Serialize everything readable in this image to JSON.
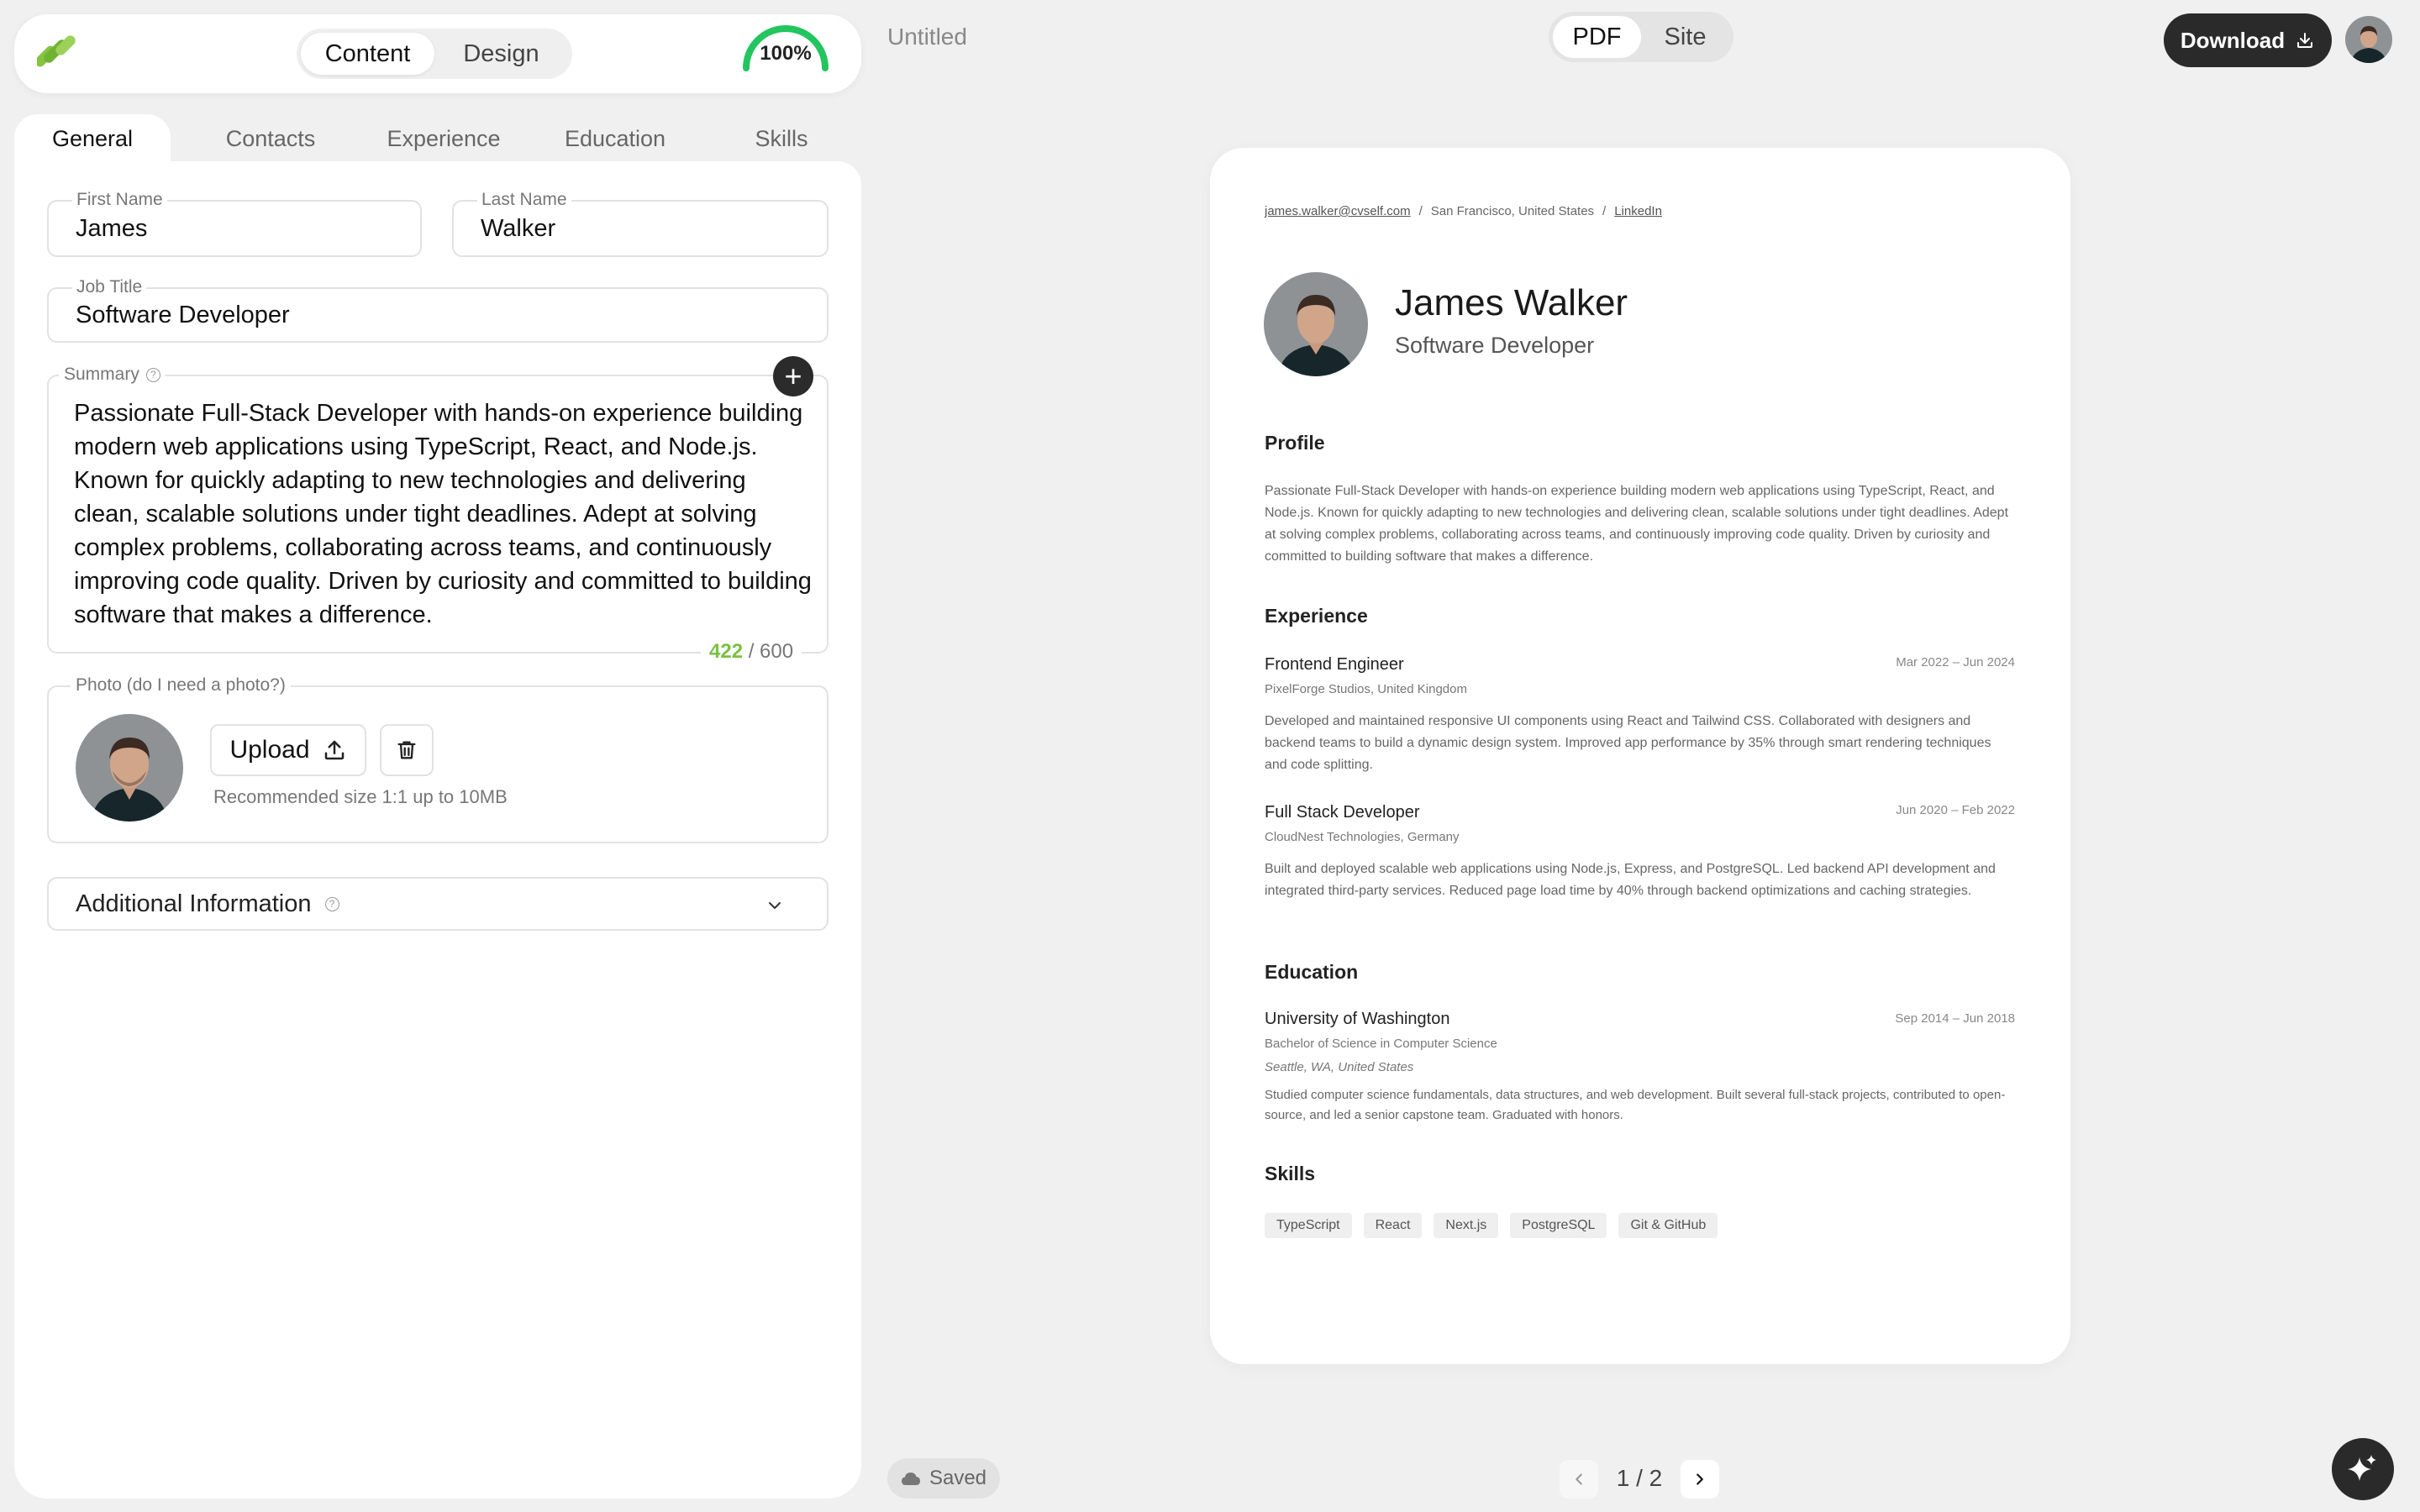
{
  "app": {
    "mode_tabs": [
      "Content",
      "Design"
    ],
    "completion": "100%",
    "completion_value": 1.0,
    "document_title": "Untitled",
    "view_tabs": [
      "PDF",
      "Site"
    ],
    "download_label": "Download",
    "saved_label": "Saved",
    "pager": "1 / 2"
  },
  "section_tabs": [
    "General",
    "Contacts",
    "Experience",
    "Education",
    "Skills"
  ],
  "form": {
    "first_name": {
      "label": "First Name",
      "value": "James"
    },
    "last_name": {
      "label": "Last Name",
      "value": "Walker"
    },
    "job_title": {
      "label": "Job Title",
      "value": "Software Developer"
    },
    "summary": {
      "label": "Summary",
      "value": "Passionate Full-Stack Developer with hands-on experience building modern web applications using TypeScript, React, and Node.js. Known for quickly adapting to new technologies and delivering clean, scalable solutions under tight deadlines. Adept at solving complex problems, collaborating across teams, and continuously improving code quality. Driven by curiosity and committed to building software that makes a difference.",
      "count": "422",
      "max": "/ 600"
    },
    "photo": {
      "label": "Photo  (do I need a photo?)",
      "upload_label": "Upload",
      "hint": "Recommended size 1:1 up to 10MB"
    },
    "additional_info_label": "Additional Information"
  },
  "resume": {
    "contacts": [
      "james.walker@cvself.com",
      "/",
      "San Francisco, United States",
      "/",
      "LinkedIn"
    ],
    "name": "James Walker",
    "job_title": "Software Developer",
    "profile_heading": "Profile",
    "profile_text": "Passionate Full-Stack Developer with hands-on experience building modern web applications using TypeScript, React, and Node.js. Known for quickly adapting to new technologies and delivering clean, scalable solutions under tight deadlines. Adept at solving complex problems, collaborating across teams, and continuously improving code quality. Driven by curiosity and committed to building software that makes a difference.",
    "experience_heading": "Experience",
    "experience": [
      {
        "title": "Frontend Engineer",
        "company": "PixelForge Studios, United Kingdom",
        "dates": "Mar 2022 – Jun 2024",
        "description": "Developed and maintained responsive UI components using React and Tailwind CSS. Collaborated with designers and backend teams to build a dynamic design system. Improved app performance by 35% through smart rendering techniques and code splitting."
      },
      {
        "title": "Full Stack Developer",
        "company": "CloudNest Technologies, Germany",
        "dates": "Jun 2020 – Feb 2022",
        "description": "Built and deployed scalable web applications using Node.js, Express, and PostgreSQL. Led backend API development and integrated third-party services. Reduced page load time by 40% through backend optimizations and caching strategies."
      }
    ],
    "education_heading": "Education",
    "education": {
      "school": "University of Washington",
      "degree": "Bachelor of Science in Computer Science",
      "location": "Seattle, WA, United States",
      "dates": "Sep 2014 – Jun 2018",
      "description": "Studied computer science fundamentals, data structures, and web development. Built several full-stack projects, contributed to open-source, and led a senior capstone team. Graduated with honors."
    },
    "skills_heading": "Skills",
    "skills": [
      "TypeScript",
      "React",
      "Next.js",
      "PostgreSQL",
      "Git & GitHub"
    ]
  },
  "colors": {
    "accent_green": "#7ac143",
    "gauge_green": "#22c55e",
    "dark_button": "#2a2a2a"
  },
  "icons": [
    "logo-icon",
    "question-icon",
    "plus-icon",
    "upload-icon",
    "trash-icon",
    "chevron-down-icon",
    "download-icon",
    "cloud-icon",
    "chevron-left-icon",
    "chevron-right-icon",
    "sparkle-icon"
  ]
}
